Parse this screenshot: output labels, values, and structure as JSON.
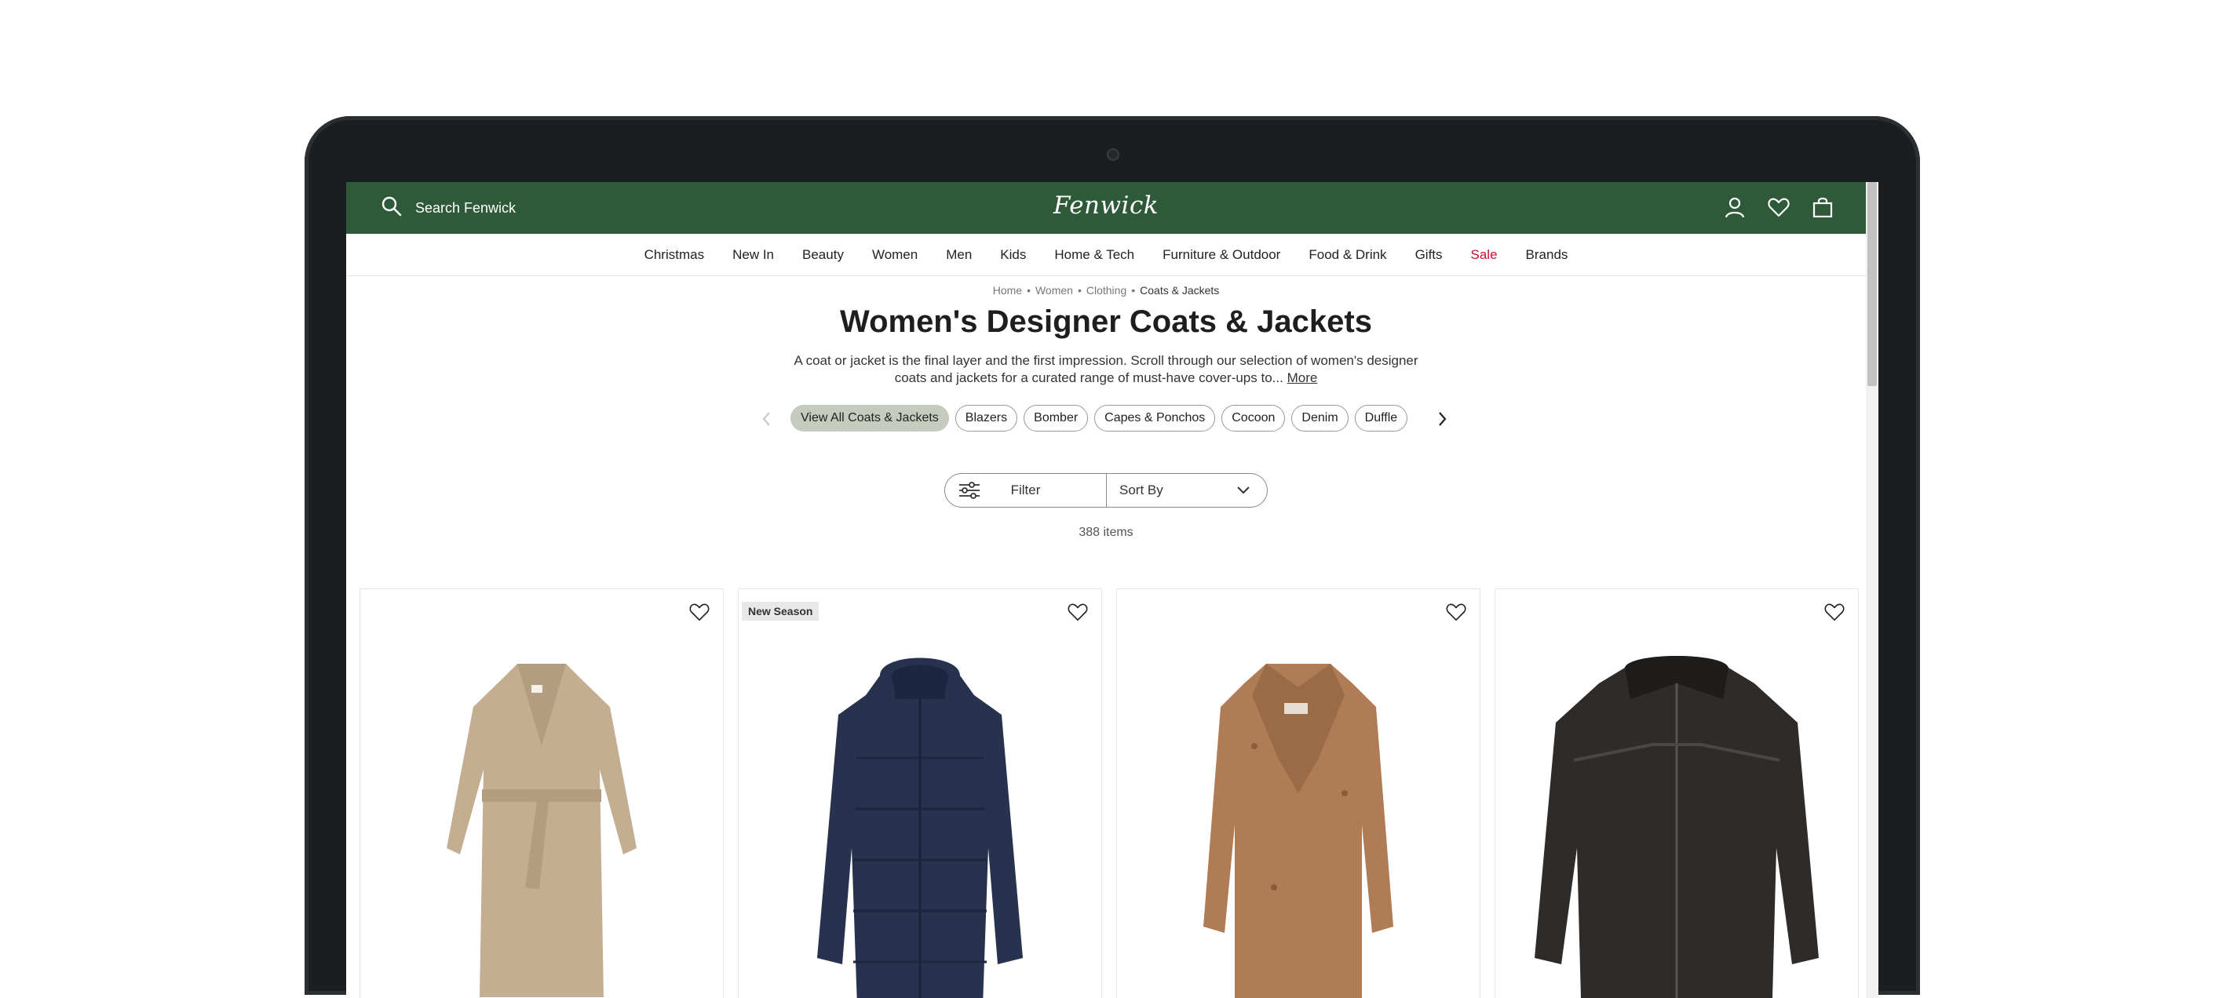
{
  "header": {
    "search_placeholder": "Search Fenwick",
    "logo": "Fenwick"
  },
  "nav": {
    "items": [
      "Christmas",
      "New In",
      "Beauty",
      "Women",
      "Men",
      "Kids",
      "Home & Tech",
      "Furniture & Outdoor",
      "Food & Drink",
      "Gifts",
      "Sale",
      "Brands"
    ]
  },
  "breadcrumb": [
    "Home",
    "Women",
    "Clothing",
    "Coats & Jackets"
  ],
  "page": {
    "title": "Women's Designer Coats & Jackets",
    "description": "A coat or jacket is the final layer and the first impression. Scroll through our selection of women's designer coats and jackets for a curated range of must-have cover-ups to...",
    "more_link": "More",
    "item_count": "388 items"
  },
  "chips": [
    "View All Coats & Jackets",
    "Blazers",
    "Bomber",
    "Capes & Ponchos",
    "Cocoon",
    "Denim",
    "Duffle"
  ],
  "controls": {
    "filter_label": "Filter",
    "sort_label": "Sort By"
  },
  "products": [
    {
      "badge": "",
      "color": "#c4ae92",
      "icon": "wrap-coat"
    },
    {
      "badge": "New Season",
      "color": "#27324f",
      "icon": "puffer-jacket"
    },
    {
      "badge": "",
      "color": "#b07c55",
      "icon": "teddy-coat"
    },
    {
      "badge": "",
      "color": "#2e2b29",
      "icon": "shearling-jacket"
    }
  ],
  "colors": {
    "header_green": "#2f5a39",
    "sale_red": "#c8102e",
    "chip_active": "#c5cbbf"
  }
}
